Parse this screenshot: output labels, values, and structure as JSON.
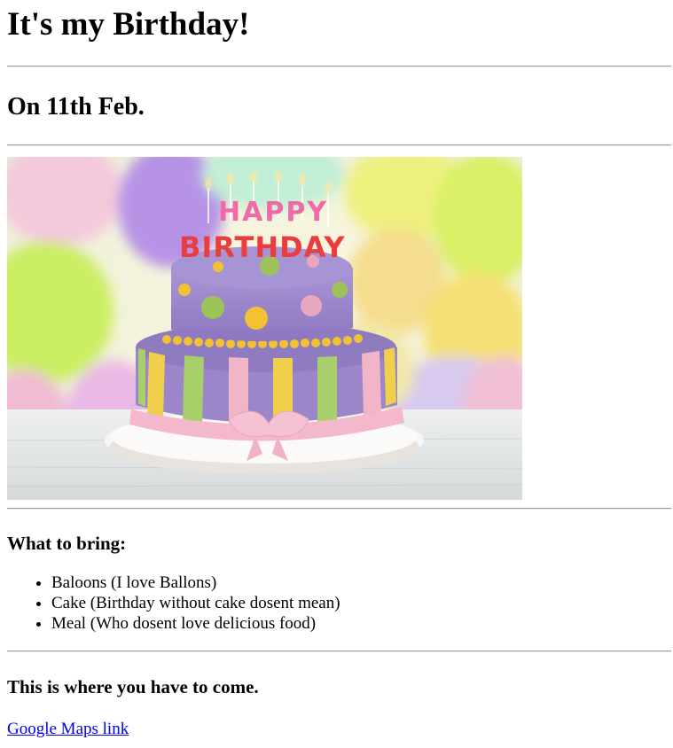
{
  "header": {
    "title": "It's my Birthday!"
  },
  "date": {
    "text": "On 11th Feb."
  },
  "cake_image": {
    "topper": {
      "word1": "HAPPY",
      "word2": "BIRTHDAY"
    },
    "colors": {
      "cake_purple": "#9b86c9",
      "dot_green": "#9bc35a",
      "dot_yellow": "#f2c233",
      "dot_pink": "#e9a6c0",
      "ribbon_pink": "#f3b8cb",
      "stripe_yellow": "#f0cf4a",
      "stripe_green": "#a9cf6a",
      "stripe_pink": "#f2b5c8"
    }
  },
  "bring_section": {
    "heading": "What to bring:",
    "items": [
      "Baloons (I love Ballons)",
      "Cake (Birthday without cake dosent mean)",
      "Meal (Who dosent love delicious food)"
    ]
  },
  "location_section": {
    "heading": "This is where you have to come.",
    "link_text": "Google Maps link"
  }
}
